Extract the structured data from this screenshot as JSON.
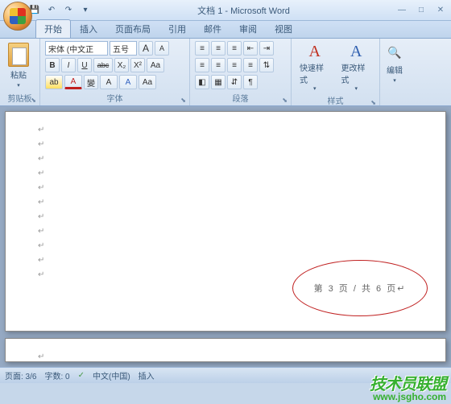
{
  "title": "文档 1 - Microsoft Word",
  "qat": {
    "save": "💾",
    "undo": "↶",
    "redo": "↷",
    "more": "▾"
  },
  "win": {
    "min": "—",
    "max": "□",
    "close": "✕"
  },
  "tabs": [
    "开始",
    "插入",
    "页面布局",
    "引用",
    "邮件",
    "审阅",
    "视图"
  ],
  "ribbon": {
    "clipboard": {
      "label": "剪贴板",
      "paste": "粘贴",
      "paste_arrow": "▾"
    },
    "font": {
      "label": "字体",
      "family": "宋体 (中文正",
      "size": "五号",
      "grow": "A",
      "shrink": "A",
      "clear": "Aa",
      "bold": "B",
      "italic": "I",
      "underline": "U",
      "strike": "abc",
      "sub": "X₂",
      "sup": "X²",
      "case": "Aa",
      "highlight": "ab",
      "color": "A",
      "phonetic": "變",
      "border": "A",
      "effects": "A"
    },
    "para": {
      "label": "段落",
      "ul": "≡",
      "ol": "≡",
      "ml": "≡",
      "dedent": "⇤",
      "indent": "⇥",
      "alignL": "≡",
      "alignC": "≡",
      "alignR": "≡",
      "alignJ": "≡",
      "spacing": "⇅",
      "shading": "◧",
      "borders": "▦",
      "sort": "⇵",
      "marks": "¶"
    },
    "styles": {
      "label": "样式",
      "quick": "快速样式",
      "change": "更改样式",
      "arrow": "▾"
    },
    "editing": {
      "label": "编辑",
      "arrow": "▾"
    }
  },
  "doc": {
    "paragraph_mark": "↵",
    "annot": "第 3 页 / 共 6 页↵"
  },
  "status": {
    "page": "页面: 3/6",
    "words": "字数: 0",
    "lang_icon": "✓",
    "lang": "中文(中国)",
    "mode": "插入"
  },
  "watermark": {
    "text": "技术员联盟",
    "url": "www.jsgho.com"
  }
}
